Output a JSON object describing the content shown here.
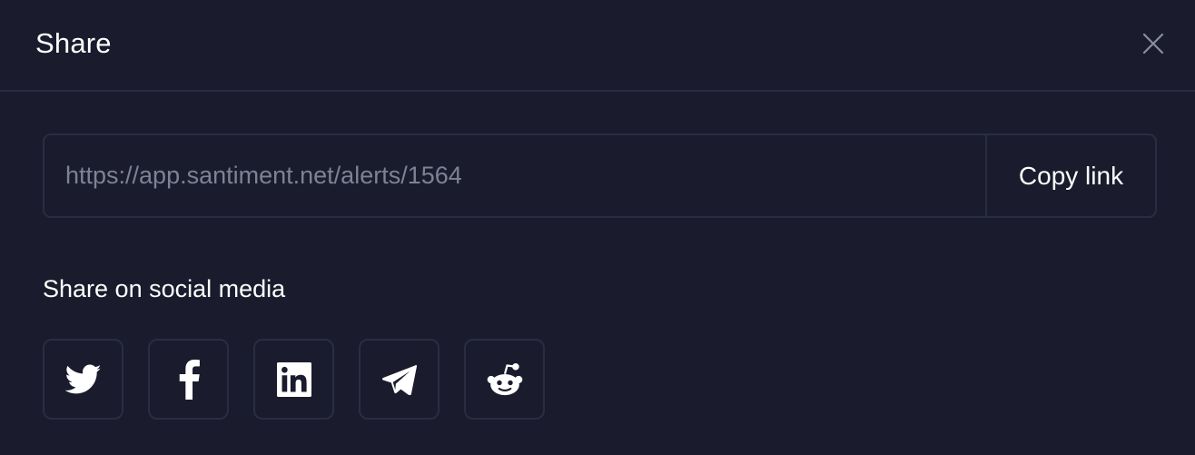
{
  "dialog": {
    "title": "Share",
    "close_icon": "close-icon"
  },
  "link": {
    "value": "https://app.santiment.net/alerts/1564",
    "copy_label": "Copy link"
  },
  "social": {
    "heading": "Share on social media",
    "items": [
      {
        "name": "twitter",
        "icon": "twitter-icon"
      },
      {
        "name": "facebook",
        "icon": "facebook-icon"
      },
      {
        "name": "linkedin",
        "icon": "linkedin-icon"
      },
      {
        "name": "telegram",
        "icon": "telegram-icon"
      },
      {
        "name": "reddit",
        "icon": "reddit-icon"
      }
    ]
  },
  "colors": {
    "background": "#1a1c2d",
    "border": "#2a2d42",
    "text": "#ffffff",
    "muted_text": "#7d8294",
    "close_icon": "#8a8ea0"
  }
}
